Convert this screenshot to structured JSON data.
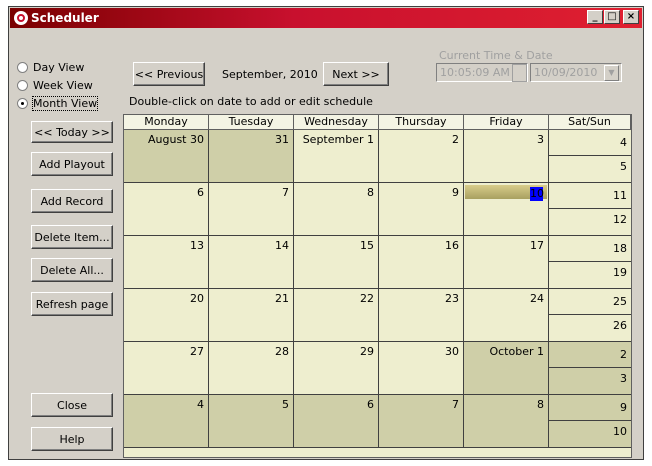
{
  "window": {
    "title": "Scheduler"
  },
  "view_options": [
    {
      "label": "Day View",
      "selected": false
    },
    {
      "label": "Week View",
      "selected": false
    },
    {
      "label": "Month View",
      "selected": true
    }
  ],
  "sidebar": {
    "today": "<< Today >>",
    "add_playout": "Add Playout",
    "add_record": "Add Record",
    "delete_item": "Delete Item...",
    "delete_all": "Delete All...",
    "refresh": "Refresh page",
    "close": "Close",
    "help": "Help"
  },
  "nav": {
    "previous": "<< Previous",
    "month_label": "September, 2010",
    "next": "Next >>",
    "hint": "Double-click on date to add or edit schedule"
  },
  "current_time": {
    "label": "Current Time & Date",
    "time": "10:05:09 AM",
    "date": "10/09/2010"
  },
  "calendar": {
    "headers": [
      "Monday",
      "Tuesday",
      "Wednesday",
      "Thursday",
      "Friday",
      "Sat/Sun"
    ],
    "weeks": [
      {
        "days": [
          "August 30",
          "31",
          "September 1",
          "2",
          "3"
        ],
        "weekend": [
          "4",
          "5"
        ],
        "out": [
          true,
          true,
          false,
          false,
          false
        ],
        "weekend_out": [
          false,
          false
        ]
      },
      {
        "days": [
          "6",
          "7",
          "8",
          "9",
          "10"
        ],
        "weekend": [
          "11",
          "12"
        ],
        "out": [
          false,
          false,
          false,
          false,
          false
        ],
        "weekend_out": [
          false,
          false
        ]
      },
      {
        "days": [
          "13",
          "14",
          "15",
          "16",
          "17"
        ],
        "weekend": [
          "18",
          "19"
        ],
        "out": [
          false,
          false,
          false,
          false,
          false
        ],
        "weekend_out": [
          false,
          false
        ]
      },
      {
        "days": [
          "20",
          "21",
          "22",
          "23",
          "24"
        ],
        "weekend": [
          "25",
          "26"
        ],
        "out": [
          false,
          false,
          false,
          false,
          false
        ],
        "weekend_out": [
          false,
          false
        ]
      },
      {
        "days": [
          "27",
          "28",
          "29",
          "30",
          "October 1"
        ],
        "weekend": [
          "2",
          "3"
        ],
        "out": [
          false,
          false,
          false,
          false,
          true
        ],
        "weekend_out": [
          true,
          true
        ]
      },
      {
        "days": [
          "4",
          "5",
          "6",
          "7",
          "8"
        ],
        "weekend": [
          "9",
          "10"
        ],
        "out": [
          true,
          true,
          true,
          true,
          true
        ],
        "weekend_out": [
          true,
          true
        ]
      }
    ],
    "today": "10"
  },
  "colors": {
    "title_start": "#7a0000",
    "title_end": "#e02030",
    "cell": "#eeeecf",
    "cell_out": "#cfcfa8",
    "today_marker": "#0000ff"
  }
}
